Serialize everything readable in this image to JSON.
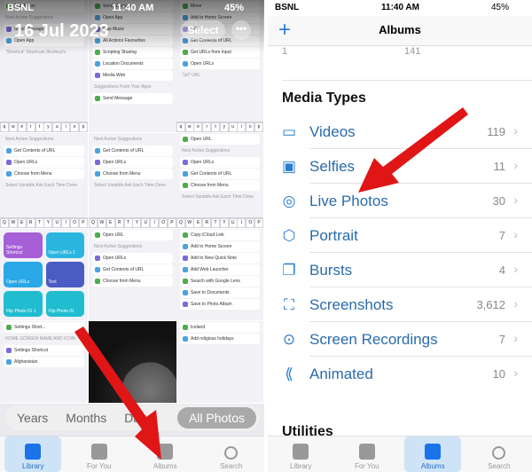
{
  "left": {
    "status": {
      "carrier": "BSNL",
      "time": "11:40 AM",
      "battery": "45%"
    },
    "date": "16 Jul 2023",
    "select_label": "Select",
    "more_label": "•••",
    "cells": [
      {
        "lines": [
          "Add Action",
          "Next Action Suggestions",
          "Send Message",
          "Open App",
          "“Shortcut”   Shortcuts   Shortcut's"
        ],
        "kb": "qwertyuiop"
      },
      {
        "lines": [
          "Send Message",
          "Open App",
          "Play Music",
          "All Actions   Favourites",
          "Scripting   Sharing",
          "Location   Documents",
          "Media   Web",
          "Suggestions From Your Apps",
          "Send Message"
        ]
      },
      {
        "lines": [
          "Move",
          "Add to Home Screen",
          "URL",
          "Get Contents of URL",
          "Get URLs from Input",
          "Open URLs",
          "“Url”   URL"
        ],
        "kb": "qwertyuiop"
      },
      {
        "lines": [
          "Next Action Suggestions",
          "Get Contents of URL",
          "Open URLs",
          "Choose from Menu",
          "Select Variable  Ask Each Time  Done"
        ],
        "kb": "QWERTYUIOP"
      },
      {
        "lines": [
          "Next Action Suggestions",
          "Get Contents of URL",
          "Open URLs",
          "Choose from Menu",
          "Select Variable  Ask Each Time  Done"
        ],
        "kb": "QWERTYUIOP"
      },
      {
        "lines": [
          "Open  URL",
          "Next Action Suggestions",
          "Open URLs",
          "Get Contents of URL",
          "Choose from Menu",
          "Select Variable  Ask Each Time  Done"
        ],
        "kb": "QWERTYUIOP"
      },
      {
        "tiles": [
          {
            "label": "Settings Shortcut",
            "color": "#a65fd6"
          },
          {
            "label": "Open URLs 1",
            "color": "#2bb6e0"
          },
          {
            "label": "Open URLs",
            "color": "#2aa7e6"
          },
          {
            "label": "Text",
            "color": "#4a5bc4"
          },
          {
            "label": "Flip Photo 01 1",
            "color": "#20bcd0"
          },
          {
            "label": "Flip Photo 01",
            "color": "#20bcd0"
          }
        ]
      },
      {
        "lines": [
          "Open  URL",
          "Next Action Suggestions",
          "Open URLs",
          "Get Contents of URL",
          "Choose from Menu"
        ]
      },
      {
        "lines": [
          "Copy iCloud Link",
          "Add to Home Screen",
          "Add to New Quick Note",
          "Add Web Launcher",
          "Search with Google Lens",
          "Save to Documents",
          "Save to Photo Album"
        ]
      },
      {
        "lines": [
          "Settings Short...",
          "HOME SCREEN NAME AND ICON",
          "Settings Shortcut",
          "Afghanistan"
        ]
      },
      {
        "photo": true
      },
      {
        "lines": [
          "Iceland",
          "Add religious holidays"
        ]
      }
    ],
    "segments": [
      "Years",
      "Months",
      "Days",
      "All Photos"
    ],
    "active_segment": "All Photos",
    "tabs": [
      {
        "label": "Library",
        "icon": "photos-library-icon",
        "active": true
      },
      {
        "label": "For You",
        "icon": "for-you-icon"
      },
      {
        "label": "Albums",
        "icon": "albums-icon"
      },
      {
        "label": "Search",
        "icon": "search-icon"
      }
    ]
  },
  "right": {
    "status": {
      "carrier": "BSNL",
      "time": "11:40 AM",
      "battery": "45%"
    },
    "title": "Albums",
    "add_label": "+",
    "top_row": {
      "left": "1",
      "count": "141"
    },
    "section": "Media Types",
    "items": [
      {
        "label": "Videos",
        "count": "119",
        "icon": "video-icon",
        "glyph": "▭"
      },
      {
        "label": "Selfies",
        "count": "11",
        "icon": "selfie-icon",
        "glyph": "▣"
      },
      {
        "label": "Live Photos",
        "count": "30",
        "icon": "live-photos-icon",
        "glyph": "◎"
      },
      {
        "label": "Portrait",
        "count": "7",
        "icon": "portrait-cube-icon",
        "glyph": "⬡"
      },
      {
        "label": "Bursts",
        "count": "4",
        "icon": "bursts-icon",
        "glyph": "❐"
      },
      {
        "label": "Screenshots",
        "count": "3,612",
        "icon": "screenshot-icon",
        "glyph": "⛶"
      },
      {
        "label": "Screen Recordings",
        "count": "7",
        "icon": "screen-recording-icon",
        "glyph": "⊙"
      },
      {
        "label": "Animated",
        "count": "10",
        "icon": "animated-icon",
        "glyph": "⟪"
      }
    ],
    "section2": "Utilities",
    "tabs": [
      {
        "label": "Library",
        "icon": "photos-library-icon"
      },
      {
        "label": "For You",
        "icon": "for-you-icon"
      },
      {
        "label": "Albums",
        "icon": "albums-icon",
        "active": true
      },
      {
        "label": "Search",
        "icon": "search-icon"
      }
    ]
  },
  "colors": {
    "accent": "#2a7dd1",
    "arrow": "#e01515",
    "active_tab_bg": "#cfe3f7"
  }
}
